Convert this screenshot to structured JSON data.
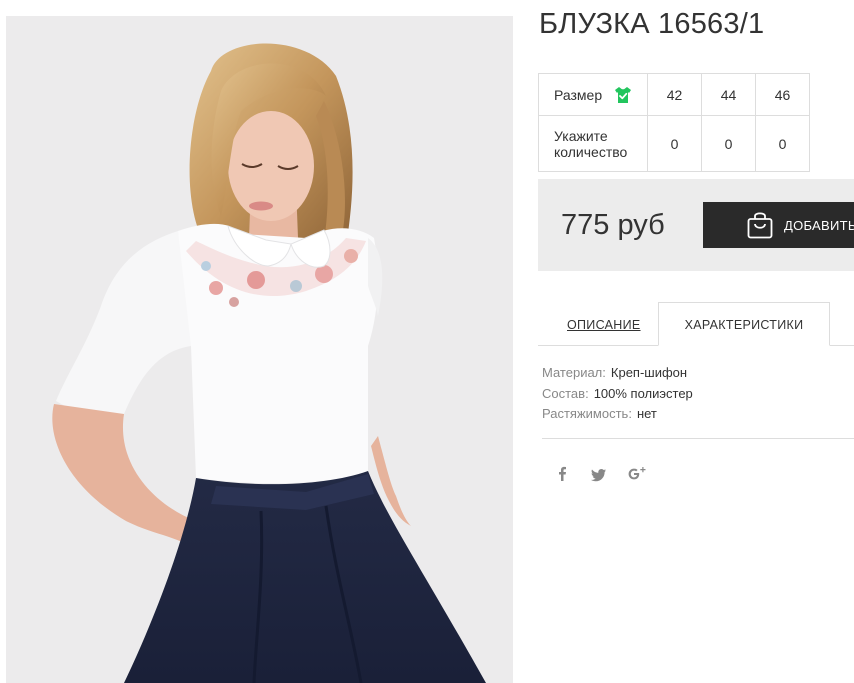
{
  "product": {
    "title": "БЛУЗКА 16563/1",
    "image_alt": "model wearing white blouse with floral collar and navy skirt"
  },
  "size_table": {
    "size_label": "Размер",
    "size_icon": "tshirt-check-icon",
    "sizes": [
      "42",
      "44",
      "46"
    ],
    "quantity_label_line1": "Укажите",
    "quantity_label_line2": "количество",
    "quantities": [
      "0",
      "0",
      "0"
    ]
  },
  "price_box": {
    "price": "775 руб",
    "add_button_label": "ДОБАВИТЬ",
    "add_icon": "shopping-bag-icon"
  },
  "tabs": {
    "description": "ОПИСАНИЕ",
    "characteristics": "ХАРАКТЕРИСТИКИ",
    "active": "characteristics"
  },
  "characteristics": [
    {
      "key": "Материал:",
      "value": "Креп-шифон"
    },
    {
      "key": "Состав:",
      "value": "100% полиэстер"
    },
    {
      "key": "Растяжимость:",
      "value": "нет"
    }
  ],
  "social": {
    "icons": [
      "facebook-icon",
      "twitter-icon",
      "google-plus-icon"
    ],
    "icon_color": "#888888"
  },
  "colors": {
    "button_bg": "#2a2a2a",
    "price_box_bg": "#ececec",
    "size_icon_green": "#22c55e"
  }
}
